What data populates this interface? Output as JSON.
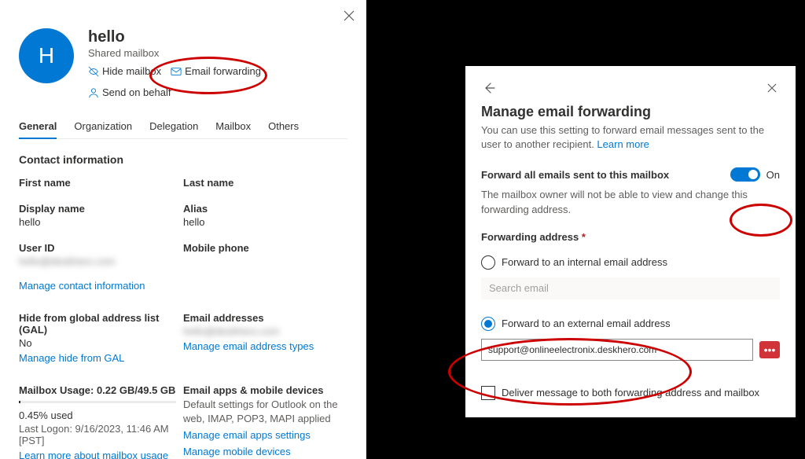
{
  "leftPanel": {
    "avatarLetter": "H",
    "mailboxName": "hello",
    "mailboxType": "Shared mailbox",
    "actions": {
      "hideMailbox": "Hide mailbox",
      "emailForwarding": "Email forwarding",
      "sendOnBehalf": "Send on behalf"
    },
    "tabs": {
      "general": "General",
      "organization": "Organization",
      "delegation": "Delegation",
      "mailbox": "Mailbox",
      "others": "Others"
    },
    "contactInfoTitle": "Contact information",
    "fields": {
      "firstNameLabel": "First name",
      "lastNameLabel": "Last name",
      "displayNameLabel": "Display name",
      "displayNameValue": "hello",
      "aliasLabel": "Alias",
      "aliasValue": "hello",
      "userIdLabel": "User ID",
      "userIdValue": "hello@deskhero.com",
      "mobilePhoneLabel": "Mobile phone"
    },
    "manageContactLink": "Manage contact information",
    "galLabel": "Hide from global address list (GAL)",
    "galValue": "No",
    "manageGalLink": "Manage hide from GAL",
    "emailAddressesLabel": "Email addresses",
    "emailAddressesValue": "hello@deskhero.com",
    "manageEmailTypesLink": "Manage email address types",
    "mailboxUsageLabel": "Mailbox Usage: 0.22 GB/49.5 GB",
    "usagePercent": "0.45% used",
    "lastLogon": "Last Logon: 9/16/2023, 11:46 AM [PST]",
    "learnMoreUsageLink": "Learn more about mailbox usage",
    "emailAppsLabel": "Email apps & mobile devices",
    "emailAppsDesc": "Default settings for Outlook on the web, IMAP, POP3, MAPI applied",
    "manageEmailAppsLink": "Manage email apps settings",
    "manageMobileLink": "Manage mobile devices"
  },
  "rightPanel": {
    "title": "Manage email forwarding",
    "subtitle": "You can use this setting to forward email messages sent to the user to another recipient. ",
    "learnMore": "Learn more",
    "forwardAllLabel": "Forward all emails sent to this mailbox",
    "toggleText": "On",
    "ownerNote": "The mailbox owner will not be able to view and change this forwarding address.",
    "forwardingAddressLabel": "Forwarding address ",
    "asterisk": "*",
    "internalLabel": "Forward to an internal email address",
    "searchPlaceholder": "Search email",
    "externalLabel": "Forward to an external email address",
    "externalValue": "support@onlineelectronix.deskhero.com",
    "addBtnText": "•••",
    "deliverBothLabel": "Deliver message to both forwarding address and mailbox"
  },
  "chart_data": {
    "type": "bar",
    "title": "Mailbox Usage",
    "categories": [
      "Used"
    ],
    "values": [
      0.22
    ],
    "total": 49.5,
    "percent": 0.45,
    "unit": "GB"
  }
}
